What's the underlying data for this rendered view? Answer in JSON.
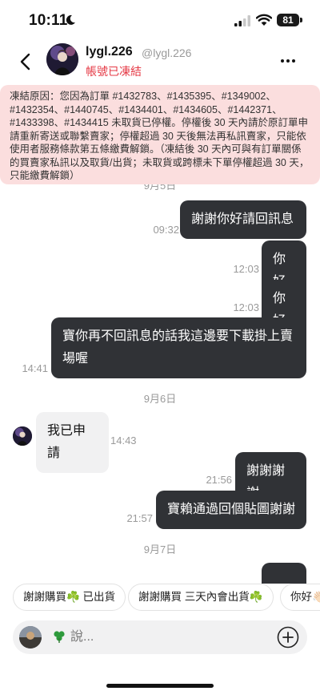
{
  "status_bar": {
    "time": "10:11",
    "battery": "81"
  },
  "header": {
    "name": "lygl.226",
    "handle": "@lygl.226",
    "status": "帳號已凍結"
  },
  "banner": {
    "text": "凍結原因：您因為訂單 #1432783、#1435395、#1349002、#1432354、#1440745、#1434401、#1434605、#1442371、#1433398、#1434415 未取貨已停權。停權後 30 天內請於原訂單申請重新寄送或聯繫賣家；停權超過 30 天後無法再私訊賣家，只能依使用者服務條款第五條繳費解鎖。（凍結後 30 天內可與有訂單關係的買賣家私訊以及取貨/出貨；未取貨或跨標未下單停權超過 30 天，只能繳費解鎖）"
  },
  "messages": {
    "date_1": "9月5日",
    "m1_text": "謝謝你好請回訊息",
    "m1_time": "09:32",
    "m2_text": "你好",
    "m2_time": "12:03",
    "m3_text": "你好",
    "m3_time": "12:03",
    "m4_text": "寶你再不回訊息的話我這邊要下載掛上賣場喔",
    "m4_time": "14:41",
    "date_2": "9月6日",
    "m5_text": "我已申請",
    "m5_time": "14:43",
    "m6_text": "謝謝謝謝",
    "m6_time": "21:56",
    "m7_text": "寶賴通過回個貼圖謝謝",
    "m7_time": "21:57",
    "date_3": "9月7日"
  },
  "quick_replies": [
    "謝謝購買☘️ 已出貨",
    "謝謝購買 三天內會出貨☘️",
    "你好👋🏻"
  ],
  "composer": {
    "placeholder": "說..."
  },
  "colors": {
    "outgoing_bubble": "#303236",
    "incoming_bubble": "#f1f1f2",
    "banner_bg": "#fbdede",
    "status_red": "#e53945"
  },
  "icons": [
    "moon-icon",
    "signal-icon",
    "wifi-icon",
    "back-arrow-icon",
    "more-icon",
    "clover-icon",
    "plus-icon"
  ]
}
